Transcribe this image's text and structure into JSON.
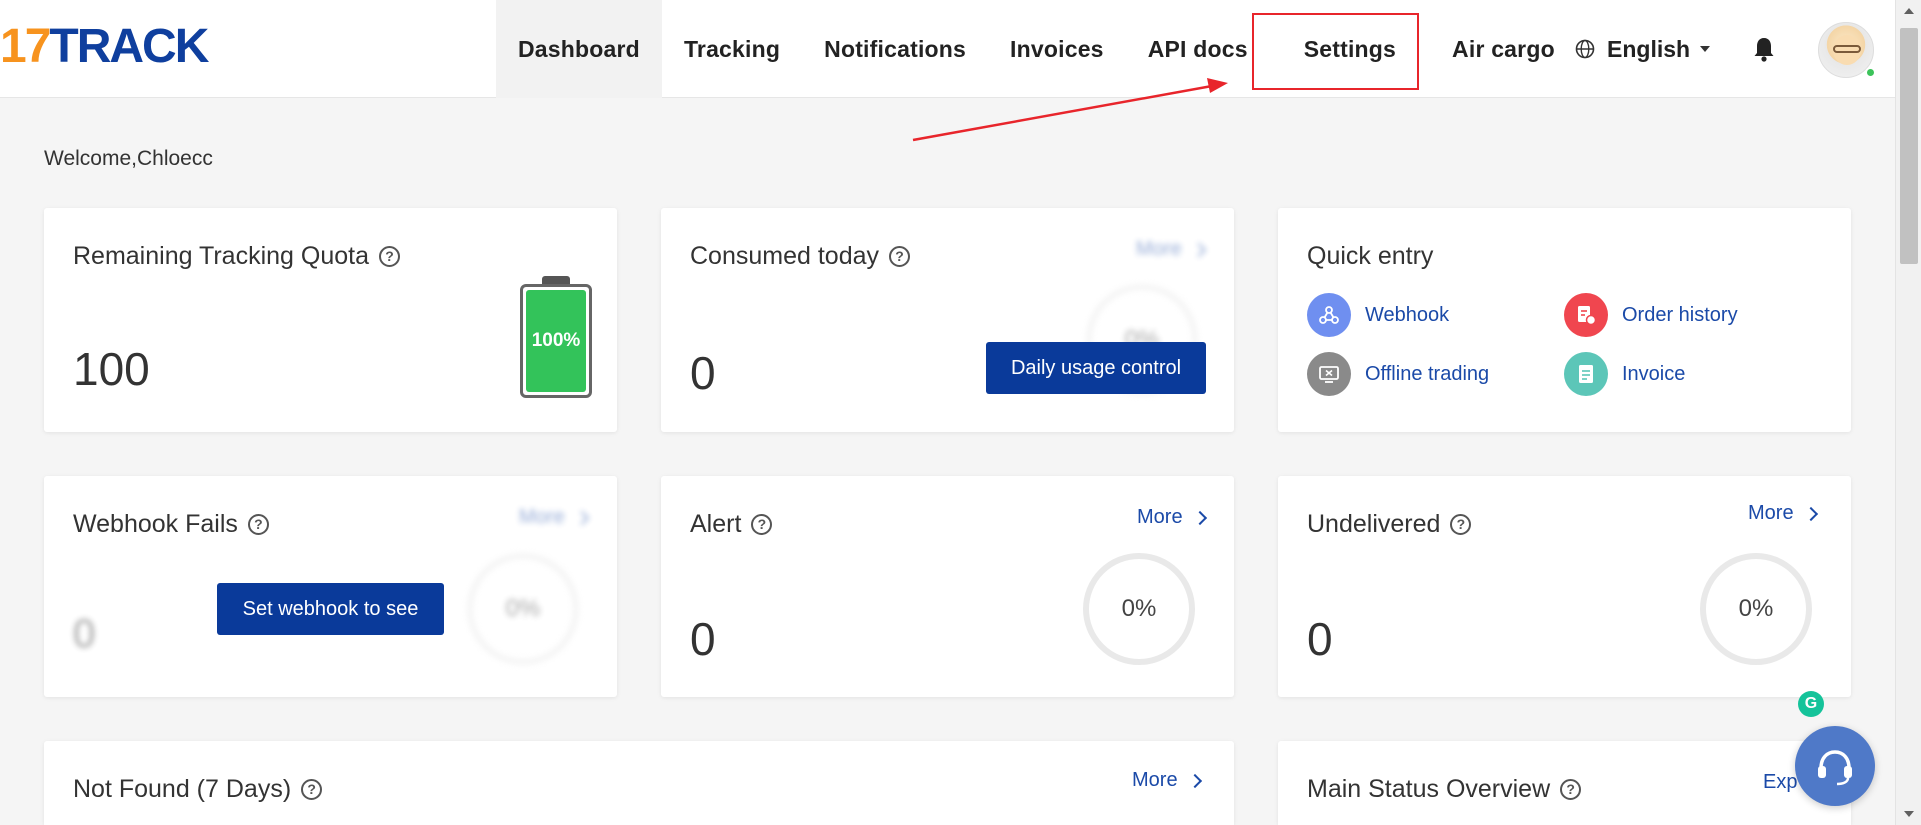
{
  "brand": {
    "logo_num": "17",
    "logo_text": "TRACK"
  },
  "nav": {
    "items": [
      {
        "label": "Dashboard",
        "active": true
      },
      {
        "label": "Tracking"
      },
      {
        "label": "Notifications"
      },
      {
        "label": "Invoices"
      },
      {
        "label": "API docs"
      },
      {
        "label": "Settings",
        "highlighted": true
      },
      {
        "label": "Air cargo"
      }
    ],
    "language": "English"
  },
  "welcome": "Welcome,Chloecc",
  "cards": {
    "quota": {
      "title": "Remaining Tracking Quota",
      "value": "100",
      "battery_label": "100%",
      "battery_level": 1.0
    },
    "consumed": {
      "title": "Consumed today",
      "value": "0",
      "more": "More",
      "ring": "0%",
      "button": "Daily usage control"
    },
    "quick": {
      "title": "Quick entry",
      "items": [
        {
          "label": "Webhook",
          "icon": "webhook-icon",
          "color": "#6f8ff0"
        },
        {
          "label": "Order history",
          "icon": "order-history-icon",
          "color": "#f0464f"
        },
        {
          "label": "Offline trading",
          "icon": "offline-trading-icon",
          "color": "#8a8a8a"
        },
        {
          "label": "Invoice",
          "icon": "invoice-icon",
          "color": "#5cc6b8"
        }
      ]
    },
    "webhook_fails": {
      "title": "Webhook Fails",
      "value": "0",
      "more": "More",
      "ring": "0%",
      "button": "Set webhook to see"
    },
    "alert": {
      "title": "Alert",
      "value": "0",
      "more": "More",
      "ring": "0%"
    },
    "undelivered": {
      "title": "Undelivered",
      "value": "0",
      "more": "More",
      "ring": "0%"
    },
    "not_found": {
      "title": "Not Found (7 Days)",
      "more": "More"
    },
    "main_status": {
      "title": "Main Status Overview",
      "export": "Exp"
    }
  },
  "floating": {
    "grammarly": "G"
  },
  "colors": {
    "accent": "#0a3a9a",
    "link": "#1b4aa8",
    "highlight": "#e8252b",
    "battery": "#33c35a"
  }
}
